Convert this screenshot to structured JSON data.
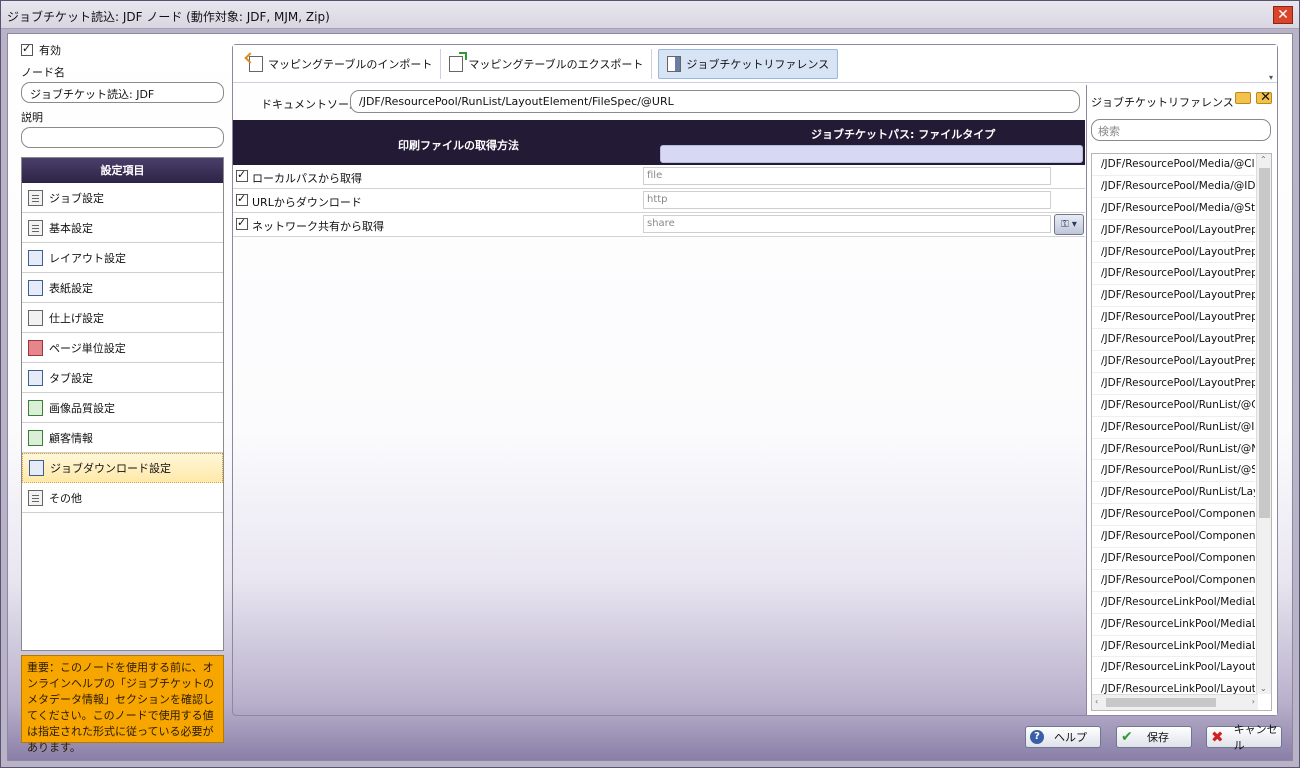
{
  "window": {
    "title": "ジョブチケット読込: JDF ノード (動作対象: JDF, MJM, Zip)",
    "close": "✕"
  },
  "left": {
    "enabled_label": "有効",
    "node_name_label": "ノード名",
    "node_name_value": "ジョブチケット読込: JDF",
    "description_label": "説明",
    "description_value": "",
    "settings_header": "設定項目",
    "items": [
      {
        "label": "ジョブ設定",
        "icon": "document-icon"
      },
      {
        "label": "基本設定",
        "icon": "list-icon"
      },
      {
        "label": "レイアウト設定",
        "icon": "layout-icon"
      },
      {
        "label": "表紙設定",
        "icon": "cover-icon"
      },
      {
        "label": "仕上げ設定",
        "icon": "finish-icon"
      },
      {
        "label": "ページ単位設定",
        "icon": "pages-icon"
      },
      {
        "label": "タブ設定",
        "icon": "tab-icon"
      },
      {
        "label": "画像品質設定",
        "icon": "image-icon"
      },
      {
        "label": "顧客情報",
        "icon": "customer-icon"
      },
      {
        "label": "ジョブダウンロード設定",
        "icon": "download-icon"
      },
      {
        "label": "その他",
        "icon": "other-icon"
      }
    ],
    "notice": "重要：このノードを使用する前に、オンラインヘルプの「ジョブチケットのメタデータ情報」セクションを確認してください。このノードで使用する値は指定された形式に従っている必要があります。"
  },
  "toolbar": {
    "import_label": "マッピングテーブルのインポート",
    "export_label": "マッピングテーブルのエクスポート",
    "reference_label": "ジョブチケットリファレンス"
  },
  "doc_source": {
    "label": "ドキュメントソース",
    "value": "/JDF/ResourcePool/RunList/LayoutElement/FileSpec/@URL"
  },
  "grid": {
    "col_method": "印刷ファイルの取得方法",
    "col_path": "ジョブチケットパス: ファイルタイプ",
    "rows": [
      {
        "label": "ローカルパスから取得",
        "value": "file",
        "checked": true
      },
      {
        "label": "URLからダウンロード",
        "value": "http",
        "checked": true
      },
      {
        "label": "ネットワーク共有から取得",
        "value": "share",
        "checked": true
      }
    ]
  },
  "reference": {
    "title": "ジョブチケットリファレンス",
    "search_placeholder": "検索",
    "items": [
      "/JDF/ResourcePool/Media/@Class",
      "/JDF/ResourcePool/Media/@ID",
      "/JDF/ResourcePool/Media/@Status",
      "/JDF/ResourcePool/LayoutPreparation",
      "/JDF/ResourcePool/LayoutPreparation",
      "/JDF/ResourcePool/LayoutPreparation",
      "/JDF/ResourcePool/LayoutPreparation",
      "/JDF/ResourcePool/LayoutPreparation",
      "/JDF/ResourcePool/LayoutPreparation",
      "/JDF/ResourcePool/LayoutPreparation",
      "/JDF/ResourcePool/LayoutPreparation",
      "/JDF/ResourcePool/RunList/@Class",
      "/JDF/ResourcePool/RunList/@ID",
      "/JDF/ResourcePool/RunList/@NPage",
      "/JDF/ResourcePool/RunList/@Status",
      "/JDF/ResourcePool/RunList/Layout",
      "/JDF/ResourcePool/Component/@",
      "/JDF/ResourcePool/Component/@",
      "/JDF/ResourcePool/Component/@",
      "/JDF/ResourcePool/Component/@",
      "/JDF/ResourceLinkPool/MediaLink",
      "/JDF/ResourceLinkPool/MediaLink",
      "/JDF/ResourceLinkPool/MediaLink",
      "/JDF/ResourceLinkPool/LayoutPre",
      "/JDF/ResourceLinkPool/LayoutPre"
    ]
  },
  "buttons": {
    "help": "ヘルプ",
    "save": "保存",
    "cancel": "キャンセル"
  }
}
